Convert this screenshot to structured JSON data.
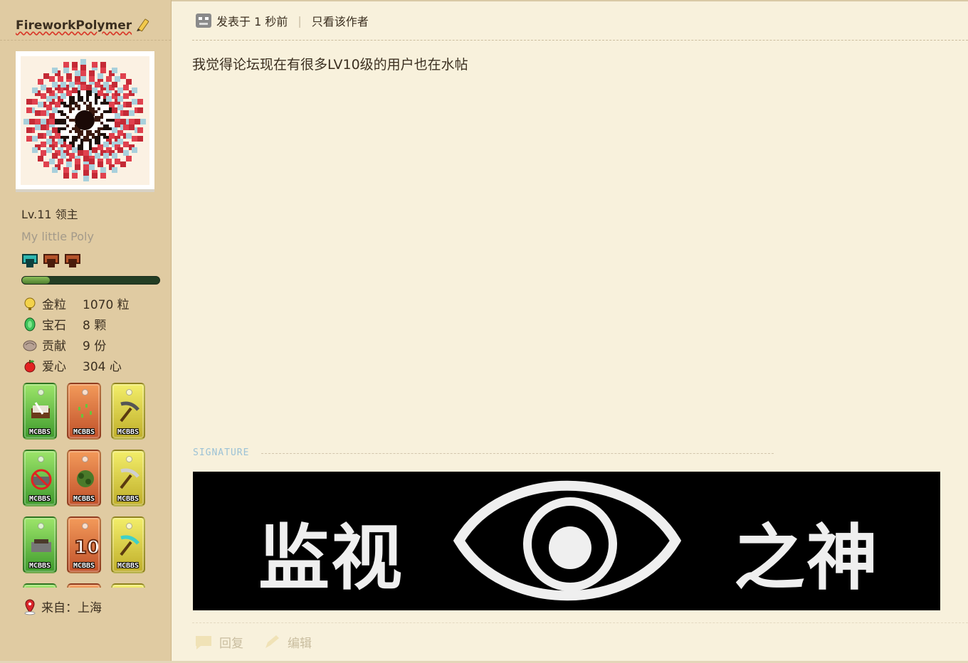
{
  "author": {
    "name": "FireworkPolymer",
    "level": "Lv.11 领主",
    "motto": "My little Poly",
    "progress_fraction": 0.2,
    "stats": [
      {
        "icon": "gold-nugget-icon",
        "label": "金粒",
        "value": "1070 粒"
      },
      {
        "icon": "emerald-icon",
        "label": "宝石",
        "value": "8 颗"
      },
      {
        "icon": "contribution-icon",
        "label": "贡献",
        "value": "9 份"
      },
      {
        "icon": "apple-heart-icon",
        "label": "爱心",
        "value": "304 心"
      }
    ],
    "medal_label": "MCBBS",
    "location": "来自：上海"
  },
  "post": {
    "meta_time": "发表于 1 秒前",
    "meta_separator": "|",
    "author_only_link": "只看该作者",
    "body": "我觉得论坛现在有很多LV10级的用户也在水帖",
    "signature_label": "SIGNATURE",
    "signature_banner": {
      "left_text": "监视",
      "right_text": "之神"
    }
  },
  "actions": {
    "reply": "回复",
    "edit": "编辑"
  },
  "colors": {
    "sidebar": "#e0cba2",
    "content": "#f8f1dc",
    "accent_red": "#d93a2a",
    "signature_label": "#9cc2d6"
  }
}
